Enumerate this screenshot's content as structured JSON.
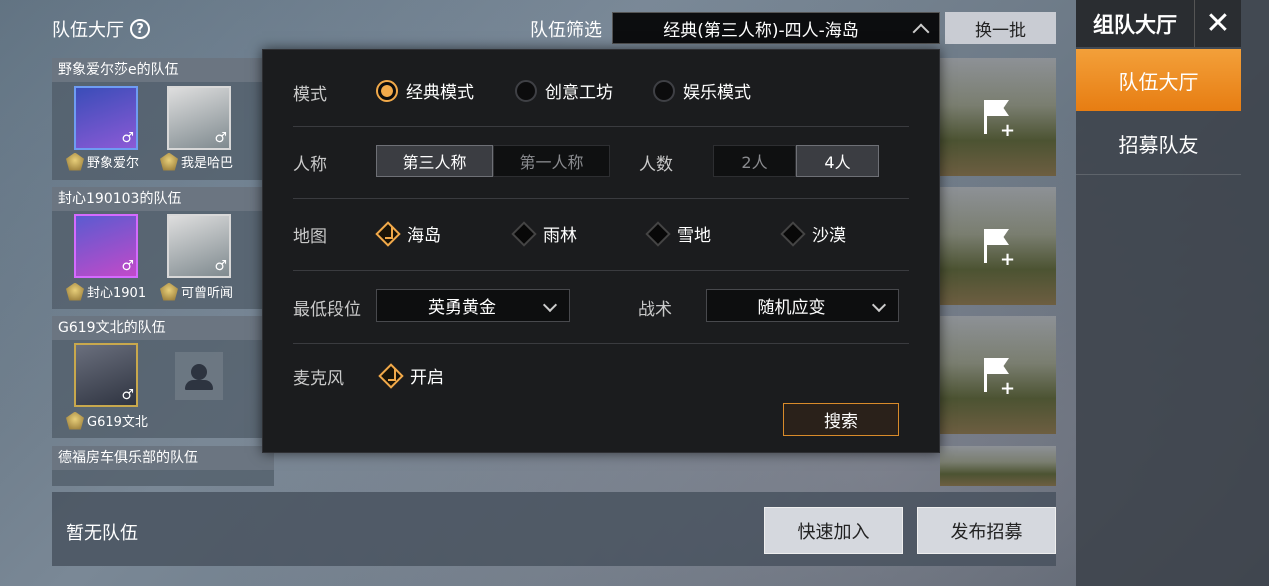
{
  "header": {
    "lobby_title": "队伍大厅",
    "filter_label": "队伍筛选",
    "filter_value": "经典(第三人称)-四人-海岛",
    "refresh_label": "换一批"
  },
  "right_panel": {
    "title": "组队大厅",
    "tabs": [
      {
        "label": "队伍大厅",
        "active": true
      },
      {
        "label": "招募队友",
        "active": false
      }
    ]
  },
  "teams": [
    {
      "name": "野象爱尔莎e的队伍",
      "members": [
        "野象爱尔",
        "我是哈巴"
      ]
    },
    {
      "name": "封心190103的队伍",
      "members": [
        "封心1901",
        "可曾听闻"
      ]
    },
    {
      "name": "G619文北的队伍",
      "members": [
        "G619文北"
      ]
    },
    {
      "name": "德福房车俱乐部的队伍",
      "members": []
    }
  ],
  "bottom": {
    "empty_text": "暂无队伍",
    "quick_join_label": "快速加入",
    "post_recruit_label": "发布招募"
  },
  "dialog": {
    "mode": {
      "label": "模式",
      "options": [
        {
          "label": "经典模式",
          "selected": true
        },
        {
          "label": "创意工坊",
          "selected": false
        },
        {
          "label": "娱乐模式",
          "selected": false
        }
      ]
    },
    "perspective": {
      "label": "人称",
      "options": [
        {
          "label": "第三人称",
          "selected": true
        },
        {
          "label": "第一人称",
          "selected": false
        }
      ]
    },
    "team_size": {
      "label": "人数",
      "options": [
        {
          "label": "2人",
          "selected": false
        },
        {
          "label": "4人",
          "selected": true
        }
      ]
    },
    "map": {
      "label": "地图",
      "options": [
        {
          "label": "海岛",
          "selected": true
        },
        {
          "label": "雨林",
          "selected": false
        },
        {
          "label": "雪地",
          "selected": false
        },
        {
          "label": "沙漠",
          "selected": false
        }
      ]
    },
    "min_rank": {
      "label": "最低段位",
      "value": "英勇黄金"
    },
    "tactics": {
      "label": "战术",
      "value": "随机应变"
    },
    "mic": {
      "label": "麦克风",
      "option_label": "开启",
      "checked": true
    },
    "search_label": "搜索"
  },
  "colors": {
    "accent": "#f1a94a",
    "active_tab": "#e77d12"
  }
}
